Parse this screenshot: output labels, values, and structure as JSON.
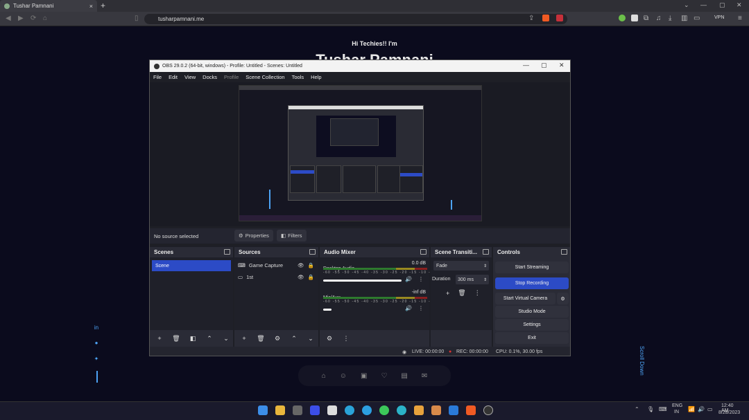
{
  "browser": {
    "tab_title": "Tushar Pamnani",
    "tab_close": "×",
    "new_tab": "+",
    "url": "tusharpamnani.me",
    "vpn": "VPN"
  },
  "site": {
    "greeting": "Hi Techies!! I'm",
    "name": "Tushar Pamnani",
    "scroll": "Scroll Down"
  },
  "obs": {
    "title": "OBS 29.0.2 (64-bit, windows) - Profile: Untitled - Scenes: Untitled",
    "menu": [
      "File",
      "Edit",
      "View",
      "Docks",
      "Profile",
      "Scene Collection",
      "Tools",
      "Help"
    ],
    "no_source": "No source selected",
    "properties": "Properties",
    "filters": "Filters",
    "scenes": {
      "title": "Scenes",
      "items": [
        "Scene"
      ]
    },
    "sources": {
      "title": "Sources",
      "items": [
        "Game Capture",
        "1st"
      ]
    },
    "mixer": {
      "title": "Audio Mixer",
      "ticks": "-60 -55 -50 -45 -40 -35 -30 -25 -20 -15 -10 -5 0",
      "channels": [
        {
          "name": "Desktop Audio",
          "db": "0.0 dB",
          "level": 0.75
        },
        {
          "name": "Mic/Aux",
          "db": "-inf dB",
          "level": 0.08
        }
      ]
    },
    "transitions": {
      "title": "Scene Transiti...",
      "type": "Fade",
      "duration_label": "Duration",
      "duration": "300 ms"
    },
    "controls": {
      "title": "Controls",
      "start_streaming": "Start Streaming",
      "stop_recording": "Stop Recording",
      "start_virtual_camera": "Start Virtual Camera",
      "studio_mode": "Studio Mode",
      "settings": "Settings",
      "exit": "Exit"
    },
    "status": {
      "live": "LIVE: 00:00:00",
      "rec": "REC: 00:00:00",
      "cpu": "CPU: 0.1%, 30.00 fps"
    }
  },
  "taskbar": {
    "lang": "ENG",
    "region": "IN",
    "time": "12:40 AM",
    "date": "8/28/2023"
  },
  "colors": {
    "accent": "#2c4bc6",
    "page_bg": "#0b0b1d",
    "link": "#4da3f5"
  }
}
